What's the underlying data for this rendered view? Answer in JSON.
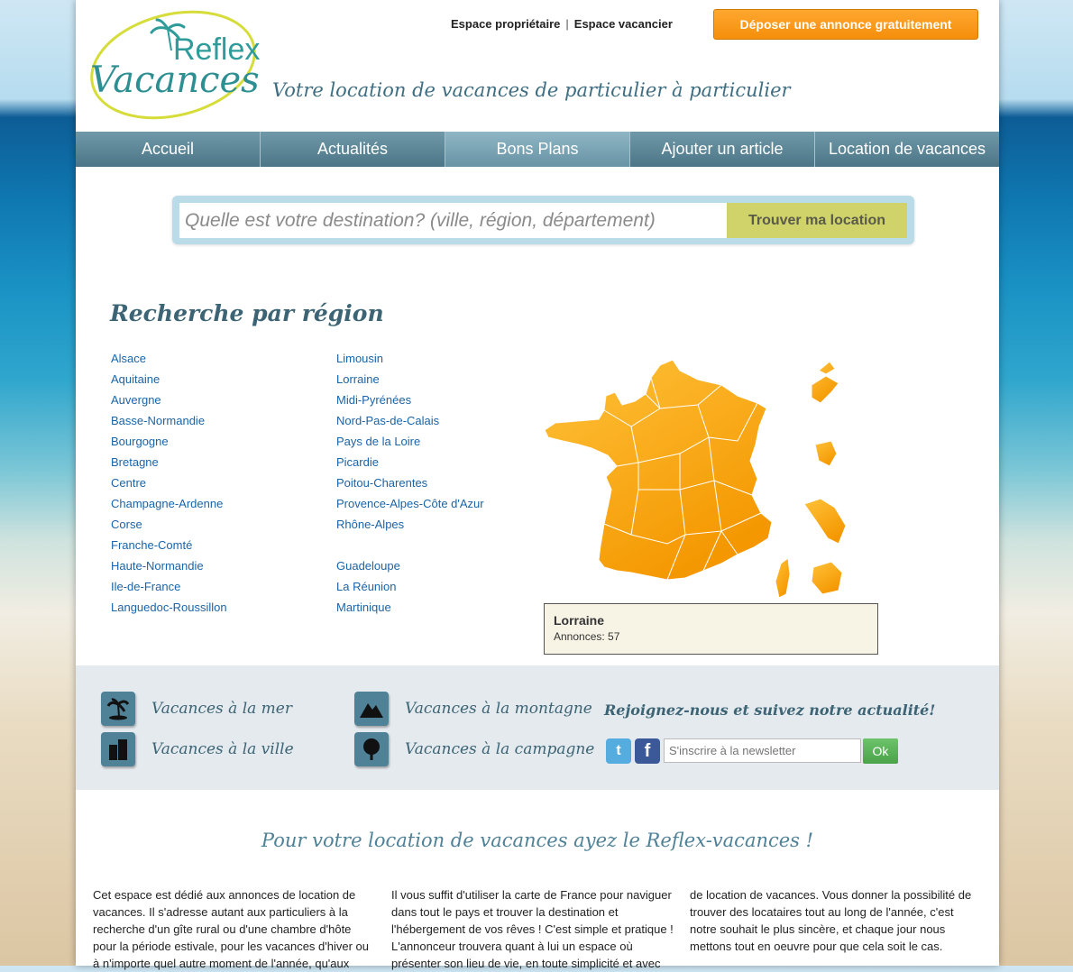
{
  "header": {
    "logo_text_top": "Reflex",
    "logo_text_bottom": "Vacances",
    "tagline": "Votre location de vacances de particulier à particulier",
    "links": [
      "Espace propriétaire",
      "Espace vacancier"
    ],
    "separator": "|",
    "cta_label": "Déposer une annonce gratuitement"
  },
  "nav": {
    "items": [
      "Accueil",
      "Actualités",
      "Bons Plans",
      "Ajouter un article",
      "Location de vacances"
    ],
    "active": "Bons Plans"
  },
  "search": {
    "placeholder": "Quelle est votre destination? (ville, région, département)",
    "button_label": "Trouver ma location"
  },
  "regions": {
    "title": "Recherche par région",
    "col1": [
      "Alsace",
      "Aquitaine",
      "Auvergne",
      "Basse-Normandie",
      "Bourgogne",
      "Bretagne",
      "Centre",
      "Champagne-Ardenne",
      "Corse",
      "Franche-Comté",
      "Haute-Normandie",
      "Ile-de-France",
      "Languedoc-Roussillon"
    ],
    "col2": [
      "Limousin",
      "Lorraine",
      "Midi-Pyrénées",
      "Nord-Pas-de-Calais",
      "Pays de la Loire",
      "Picardie",
      "Poitou-Charentes",
      "Provence-Alpes-Côte d'Azur",
      "Rhône-Alpes"
    ],
    "col2_overseas": [
      "Guadeloupe",
      "La Réunion",
      "Martinique"
    ],
    "map_color": "#f5a300"
  },
  "tooltip": {
    "region": "Lorraine",
    "count_line": "Annonces:  57"
  },
  "categories": {
    "mer": "Vacances à la mer",
    "montagne": "Vacances à la montagne",
    "ville": "Vacances à la ville",
    "campagne": "Vacances à la campagne"
  },
  "social": {
    "title": "Rejoignez-nous et suivez notre actualité!",
    "twitter_glyph": "t",
    "facebook_glyph": "f",
    "newsletter_placeholder": "S'inscrire à la newsletter",
    "ok_label": "Ok"
  },
  "intro": {
    "title": "Pour votre location de vacances ayez le Reflex-vacances !",
    "col1": "Cet espace est dédié aux annonces de location de vacances. Il s'adresse autant aux particuliers à la recherche d'un gîte rural ou d'une chambre d'hôte pour la période estivale, pour les vacances d'hiver ou à n'importe quel autre moment de l'année, qu'aux",
    "col2": "Il vous suffit d'utiliser la carte de France pour naviguer dans tout le pays et trouver la destination et l'hébergement de vos rêves ! C'est simple et pratique ! L'annonceur trouvera quant à lui un espace où présenter son lieu de vie, en toute simplicité et avec",
    "col3": "de location de vacances. Vous donner la possibilité de trouver des locataires tout au long de l'année, c'est notre souhait le plus sincère, et chaque jour nous mettons tout en oeuvre pour que cela soit le cas."
  },
  "colors": {
    "accent_orange": "#f7941d",
    "nav_blue": "#5a8496",
    "link_blue": "#1a64a8",
    "title_teal": "#3c6474",
    "search_button": "#cfd36a",
    "ok_green": "#5cb85a"
  }
}
